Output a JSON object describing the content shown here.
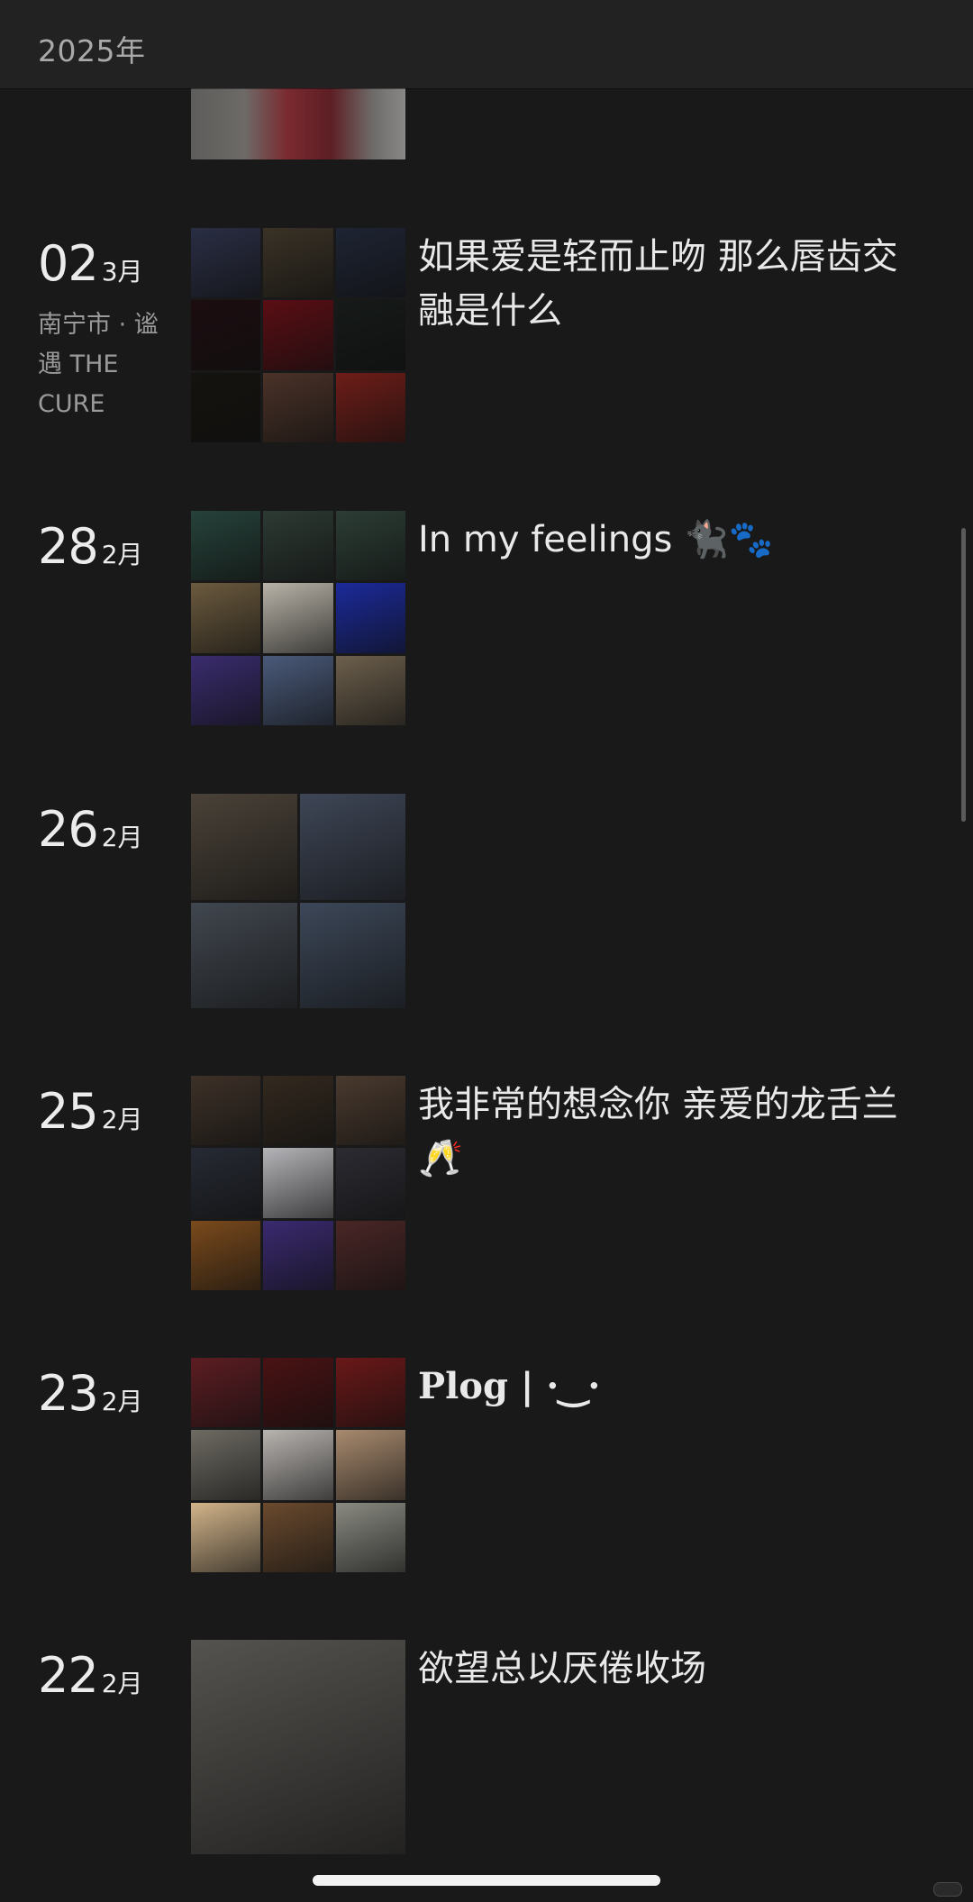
{
  "header": {
    "year": "2025年"
  },
  "entries": [
    {
      "day": "02",
      "month": "3月",
      "location": "南宁市 · 谧遇 THE CURE",
      "caption": "如果爱是轻而止吻 那么唇齿交融是什么",
      "photos": [
        "#2a2e44",
        "#3a3226",
        "#1e2433",
        "#1c0d10",
        "#5a0e14",
        "#161a18",
        "#15130f",
        "#4a3228",
        "#6e1d18"
      ]
    },
    {
      "day": "28",
      "month": "2月",
      "location": "",
      "caption": "In my feelings 🐈‍⬛🐾",
      "photos": [
        "#26423a",
        "#2d3a33",
        "#2c3d35",
        "#6b5a3e",
        "#b8b3a8",
        "#1b2a9a",
        "#3a2c6e",
        "#4a5a7a",
        "#6c5f4c"
      ]
    },
    {
      "day": "26",
      "month": "2月",
      "location": "",
      "caption": "",
      "photos": [
        "#4a4238",
        "#3e4656",
        "#41474f",
        "#3c4758"
      ]
    },
    {
      "day": "25",
      "month": "2月",
      "location": "",
      "caption": "我非常的想念你 亲爱的龙舌兰🥂",
      "photos": [
        "#3d3128",
        "#33291f",
        "#4a3a2e",
        "#262a33",
        "#b5b4b8",
        "#2c2b32",
        "#7a4a1c",
        "#3a2a70",
        "#4a2626"
      ]
    },
    {
      "day": "23",
      "month": "2月",
      "location": "",
      "caption": "Plog | ·‿·",
      "photos": [
        "#5c1d22",
        "#4a1214",
        "#6a1818",
        "#6e6b63",
        "#b8b4b0",
        "#a88a6e",
        "#d2b48a",
        "#6a4a2e",
        "#8a8a82"
      ]
    },
    {
      "day": "22",
      "month": "2月",
      "location": "",
      "caption": "欲望总以厌倦收场",
      "photos": [
        "#55534f"
      ]
    }
  ],
  "top_partial_photo": "#7a3a3f"
}
